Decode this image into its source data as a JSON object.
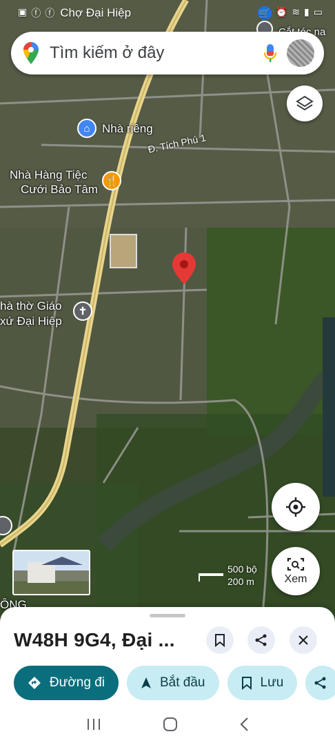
{
  "status_bar": {
    "app_title": "Chợ Đại Hiệp"
  },
  "search": {
    "placeholder": "Tìm kiếm ở đây"
  },
  "map_labels": {
    "top_right": "Cắt tóc na",
    "home": "Nhà riêng",
    "road": "Đ. Tích Phú 1",
    "restaurant_line1": "Nhà Hàng Tiệc",
    "restaurant_line2": "Cưới Bảo Tâm",
    "church_line1": "hà thờ Giáo",
    "church_line2": "xứ Đại Hiệp",
    "bottom_left": "ÔNG"
  },
  "scale": {
    "imperial": "500 bộ",
    "metric": "200 m"
  },
  "explore_button": {
    "label": "Xem"
  },
  "place": {
    "title": "W48H 9G4, Đại ..."
  },
  "actions": {
    "directions": "Đường đi",
    "start": "Bắt đầu",
    "save": "Lưu"
  },
  "colors": {
    "primary": "#0b6e7d",
    "chip": "#c7ecf3",
    "pin": "#e53935"
  }
}
